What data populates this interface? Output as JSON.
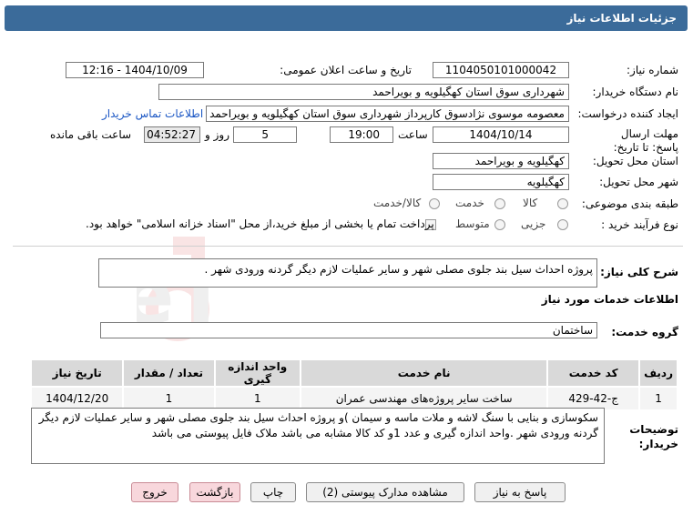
{
  "header": {
    "title": "جزئیات اطلاعات نیاز"
  },
  "fields": {
    "need_number_label": "شماره نیاز:",
    "need_number": "1104050101000042",
    "announce_label": "تاریخ و ساعت اعلان عمومی:",
    "announce_value": "1404/10/09 - 12:16",
    "buyer_org_label": "نام دستگاه خریدار:",
    "buyer_org": "شهرداری سوق استان کهگیلویه و بویراحمد",
    "creator_label": "ایجاد کننده درخواست:",
    "creator": "معصومه موسوی نژادسوق کارپرداز شهرداری سوق استان کهگیلویه و بویراحمد",
    "contact_link": "اطلاعات تماس خریدار",
    "deadline_label": "مهلت ارسال پاسخ: تا تاریخ:",
    "deadline_date": "1404/10/14",
    "time_label": "ساعت",
    "deadline_time": "19:00",
    "days_value": "5",
    "days_label": "روز و",
    "remaining_time": "04:52:27",
    "remaining_label": "ساعت باقی مانده",
    "province_label": "استان محل تحویل:",
    "province": "کهگیلویه و بویراحمد",
    "city_label": "شهر محل تحویل:",
    "city": "کهگیلویه",
    "category_label": "طبقه بندی موضوعی:",
    "category_options": [
      "کالا",
      "خدمت",
      "کالا/خدمت"
    ],
    "process_label": "نوع فرآیند خرید :",
    "process_options": [
      "جزیی",
      "متوسط"
    ],
    "treasury_note": "پرداخت تمام یا بخشی از مبلغ خرید،از محل \"اسناد خزانه اسلامی\" خواهد بود."
  },
  "summary": {
    "label": "شرح کلی نیاز:",
    "text": "پروژه احداث سیل بند جلوی مصلی شهر و سایر عملیات لازم دیگر گردنه ورودی شهر ."
  },
  "services": {
    "section_title": "اطلاعات خدمات مورد نیاز",
    "group_label": "گروه خدمت:",
    "group_value": "ساختمان",
    "columns": [
      "ردیف",
      "کد خدمت",
      "نام خدمت",
      "واحد اندازه گیری",
      "تعداد / مقدار",
      "تاریخ نیاز"
    ],
    "rows": [
      [
        "1",
        "ج-42-429",
        "ساخت سایر پروژه‌های مهندسی عمران",
        "1",
        "1",
        "1404/12/20"
      ]
    ]
  },
  "buyer_notes": {
    "label": "توضیحات خریدار:",
    "text": "سکوسازی و بنایی با سنگ لاشه و ملات ماسه و سیمان )و پروژه احداث سیل بند جلوی مصلی شهر و سایر عملیات لازم دیگر گردنه ورودی شهر .واحد اندازه گیری و عدد 1و کد کالا مشابه می باشد ملاک فایل پیوستی می باشد"
  },
  "buttons": {
    "reply": "پاسخ به نیاز",
    "attachments": "مشاهده مدارک پیوستی (2)",
    "print": "چاپ",
    "back": "بازگشت",
    "exit": "خروج"
  },
  "watermark": {
    "text": "AriaTender.neT"
  },
  "colors": {
    "header": "#3b6b9a",
    "link": "#1a56c4",
    "button_pink": "#f8d7dc"
  }
}
